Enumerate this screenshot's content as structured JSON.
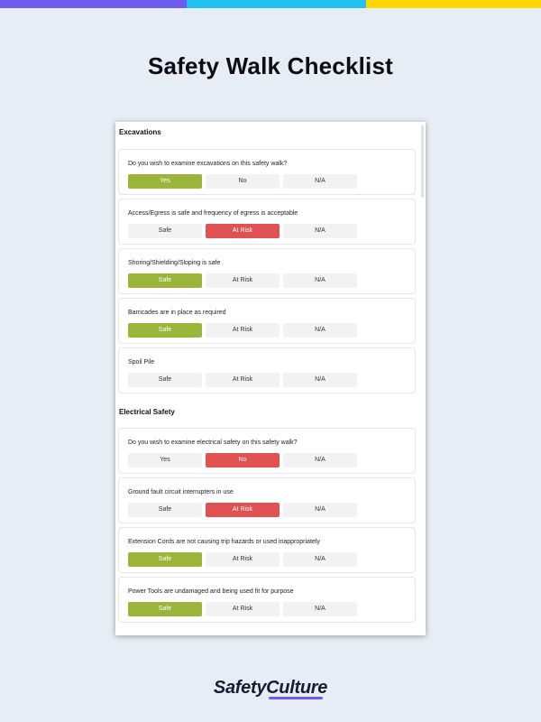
{
  "title": "Safety Walk Checklist",
  "logo_text": "SafetyCulture",
  "colors": {
    "selected_safe": "#9bb53a",
    "selected_risk": "#e05252",
    "unselected": "#f2f2f2"
  },
  "sections": [
    {
      "title": "Excavations",
      "items": [
        {
          "question": "Do you wish to examine excavations on this safety walk?",
          "options": [
            "Yes",
            "No",
            "N/A"
          ],
          "selected": 0,
          "selected_color": "green"
        },
        {
          "question": "Access/Egress is safe and frequency of egress is acceptable",
          "options": [
            "Safe",
            "At Risk",
            "N/A"
          ],
          "selected": 1,
          "selected_color": "red"
        },
        {
          "question": "Shoring/Shielding/Sloping is safe",
          "options": [
            "Safe",
            "At Risk",
            "N/A"
          ],
          "selected": 0,
          "selected_color": "green"
        },
        {
          "question": "Barricades are in place as required",
          "options": [
            "Safe",
            "At Risk",
            "N/A"
          ],
          "selected": 0,
          "selected_color": "green"
        },
        {
          "question": "Spoil Pile",
          "options": [
            "Safe",
            "At Risk",
            "N/A"
          ],
          "selected": null,
          "selected_color": null
        }
      ]
    },
    {
      "title": "Electrical Safety",
      "items": [
        {
          "question": "Do you wish to examine electrical safety on this safety walk?",
          "options": [
            "Yes",
            "No",
            "N/A"
          ],
          "selected": 1,
          "selected_color": "red"
        },
        {
          "question": "Ground fault circuit interrupters in use",
          "options": [
            "Safe",
            "At Risk",
            "N/A"
          ],
          "selected": 1,
          "selected_color": "red"
        },
        {
          "question": "Extension Cords are not causing trip hazards or used inappropriately",
          "options": [
            "Safe",
            "At Risk",
            "N/A"
          ],
          "selected": 0,
          "selected_color": "green"
        },
        {
          "question": "Power Tools are undamaged and being used fit for purpose",
          "options": [
            "Safe",
            "At Risk",
            "N/A"
          ],
          "selected": 0,
          "selected_color": "green"
        }
      ]
    }
  ]
}
